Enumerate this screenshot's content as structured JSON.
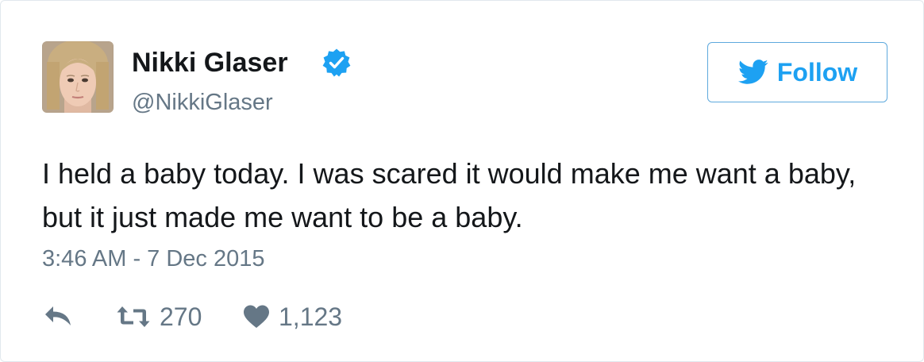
{
  "author": {
    "name": "Nikki Glaser",
    "handle": "@NikkiGlaser",
    "verified": true
  },
  "follow_button": {
    "label": "Follow",
    "icon": "twitter-bird-icon"
  },
  "tweet": {
    "text": "I held a baby today. I was scared it would make me want a baby, but it just made me want to be a baby.",
    "timestamp": "3:46 AM - 7 Dec 2015"
  },
  "actions": {
    "reply_icon": "reply-icon",
    "retweet_icon": "retweet-icon",
    "retweet_count": "270",
    "like_icon": "heart-icon",
    "like_count": "1,123"
  },
  "colors": {
    "accent": "#1da1f2",
    "button_border": "#5ea9dd",
    "verified_badge": "#1da1f2",
    "text_primary": "#14171a",
    "text_secondary": "#657786",
    "card_border": "#e1e8ed"
  }
}
